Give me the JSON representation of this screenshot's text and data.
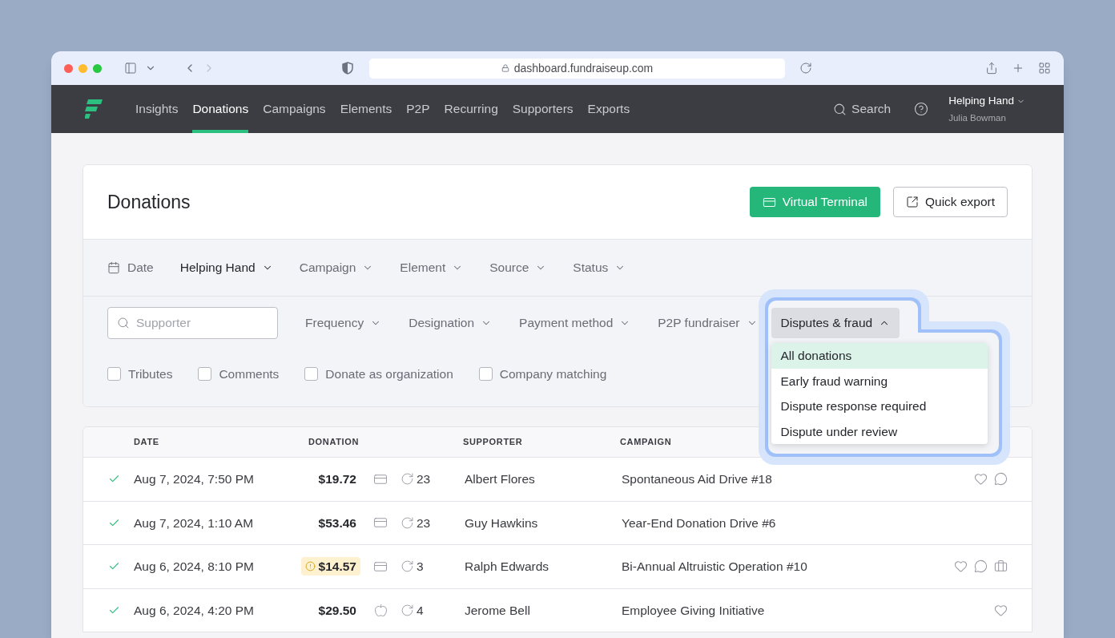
{
  "browser": {
    "url": "dashboard.fundraiseup.com"
  },
  "nav": {
    "items": [
      {
        "label": "Insights",
        "selected": false
      },
      {
        "label": "Donations",
        "selected": true
      },
      {
        "label": "Campaigns",
        "selected": false
      },
      {
        "label": "Elements",
        "selected": false
      },
      {
        "label": "P2P",
        "selected": false
      },
      {
        "label": "Recurring",
        "selected": false
      },
      {
        "label": "Supporters",
        "selected": false
      },
      {
        "label": "Exports",
        "selected": false
      }
    ],
    "search": "Search",
    "account": {
      "organization": "Helping Hand",
      "user": "Julia Bowman"
    }
  },
  "page": {
    "title": "Donations",
    "actions": [
      {
        "label": "Virtual Terminal",
        "kind": "primary"
      },
      {
        "label": "Quick export",
        "kind": "secondary"
      }
    ]
  },
  "filters": {
    "primary": [
      {
        "label": "Date",
        "kind": "date",
        "active": false
      },
      {
        "label": "Helping Hand",
        "kind": "dropdown",
        "active": true
      },
      {
        "label": "Campaign",
        "kind": "dropdown",
        "active": false
      },
      {
        "label": "Element",
        "kind": "dropdown",
        "active": false
      },
      {
        "label": "Source",
        "kind": "dropdown",
        "active": false
      },
      {
        "label": "Status",
        "kind": "dropdown",
        "active": false
      }
    ],
    "search": {
      "placeholder": "Supporter"
    },
    "secondary": [
      {
        "label": "Frequency"
      },
      {
        "label": "Designation"
      },
      {
        "label": "Payment method"
      },
      {
        "label": "P2P fundraiser"
      }
    ],
    "disputes": {
      "label": "Disputes & fraud",
      "expanded": true,
      "options": [
        {
          "label": "All donations",
          "selected": true
        },
        {
          "label": "Early fraud warning",
          "selected": false
        },
        {
          "label": "Dispute response required",
          "selected": false
        },
        {
          "label": "Dispute under review",
          "selected": false
        }
      ]
    },
    "checkboxes": [
      {
        "label": "Tributes",
        "checked": false
      },
      {
        "label": "Comments",
        "checked": false
      },
      {
        "label": "Donate as organization",
        "checked": false
      },
      {
        "label": "Company matching",
        "checked": false
      }
    ]
  },
  "table": {
    "columns": [
      {
        "label": "DATE"
      },
      {
        "label": "DONATION"
      },
      {
        "label": "SUPPORTER"
      },
      {
        "label": "CAMPAIGN"
      }
    ],
    "rows": [
      {
        "status": {
          "kind": "succeeded"
        },
        "date": "Aug 7, 2024, 7:50 PM",
        "amount": "$19.72",
        "flagged": false,
        "payment": {
          "kind": "card"
        },
        "recurring": "23",
        "supporter": "Albert Flores",
        "campaign": "Spontaneous Aid Drive #18",
        "markers": [
          {
            "kind": "heart"
          },
          {
            "kind": "comment"
          }
        ]
      },
      {
        "status": {
          "kind": "succeeded"
        },
        "date": "Aug 7, 2024, 1:10 AM",
        "amount": "$53.46",
        "flagged": false,
        "payment": {
          "kind": "card"
        },
        "recurring": "23",
        "supporter": "Guy Hawkins",
        "campaign": "Year-End Donation Drive #6",
        "markers": []
      },
      {
        "status": {
          "kind": "succeeded"
        },
        "date": "Aug 6, 2024, 8:10 PM",
        "amount": "$14.57",
        "flagged": true,
        "payment": {
          "kind": "card"
        },
        "recurring": "3",
        "supporter": "Ralph Edwards",
        "campaign": "Bi-Annual Altruistic Operation #10",
        "markers": [
          {
            "kind": "heart"
          },
          {
            "kind": "comment"
          },
          {
            "kind": "briefcase"
          }
        ]
      },
      {
        "status": {
          "kind": "succeeded"
        },
        "date": "Aug 6, 2024, 4:20 PM",
        "amount": "$29.50",
        "flagged": false,
        "payment": {
          "kind": "apple"
        },
        "recurring": "4",
        "supporter": "Jerome Bell",
        "campaign": "Employee Giving Initiative",
        "markers": [
          {
            "kind": "heart"
          }
        ]
      }
    ]
  }
}
